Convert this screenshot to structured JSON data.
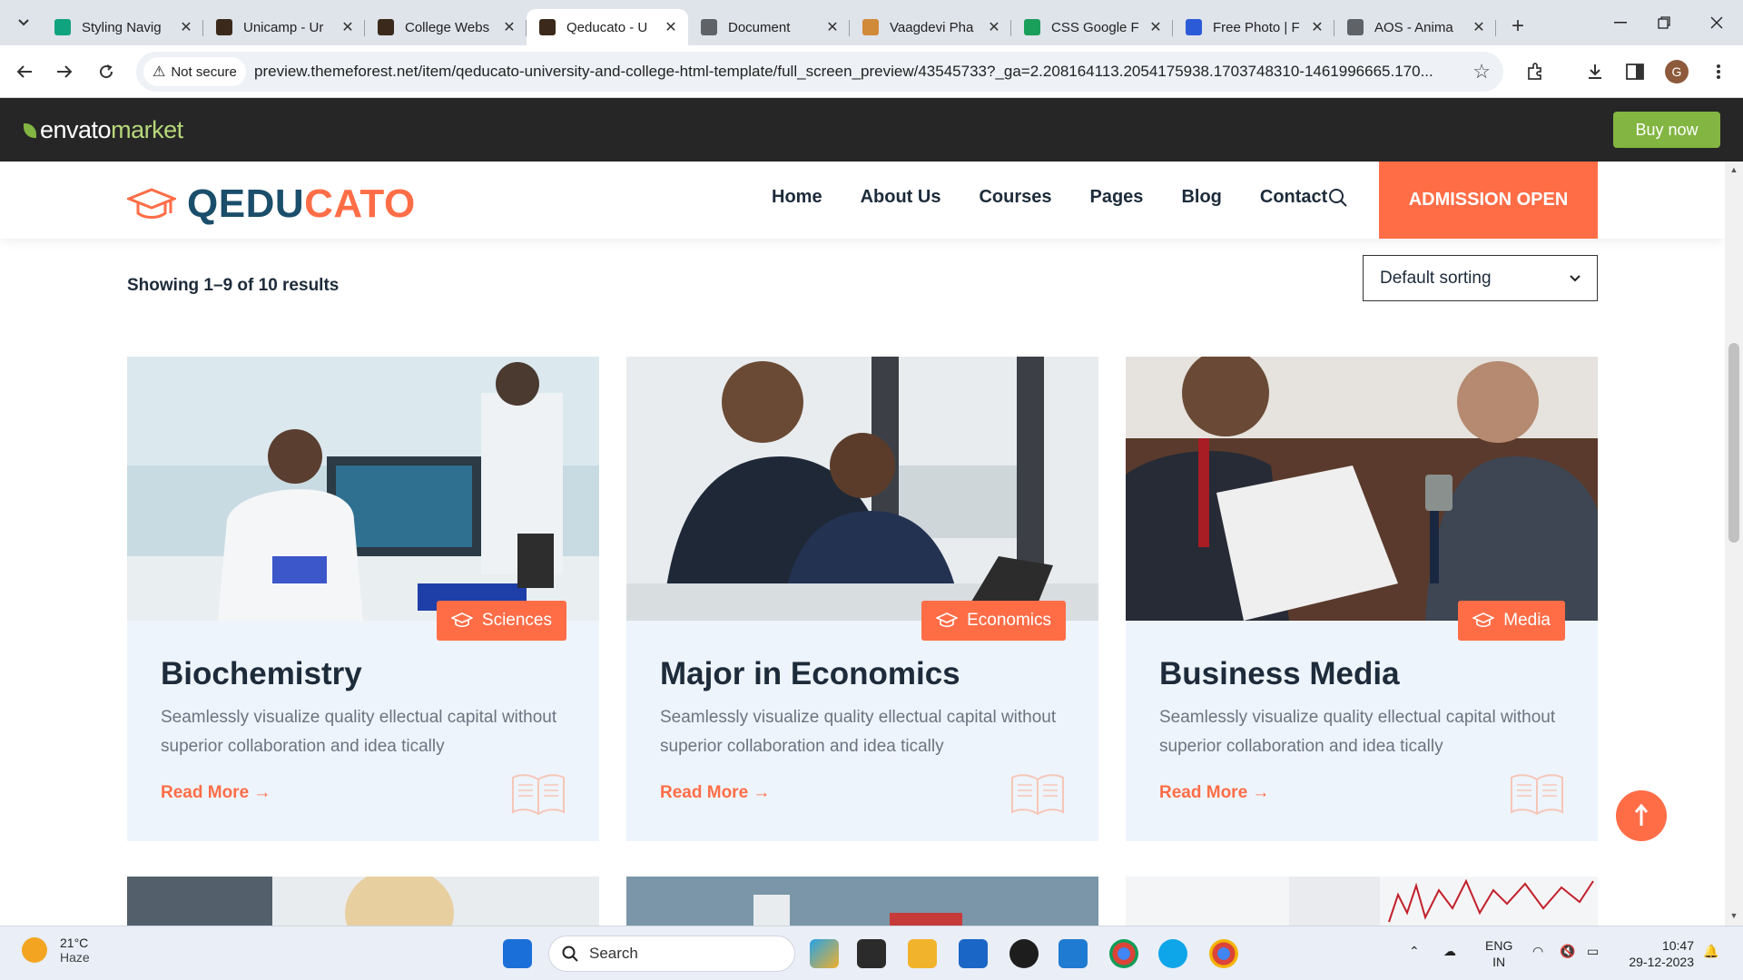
{
  "browser": {
    "tabs": [
      {
        "title": "Styling Navig",
        "favicon_color": "#10a37f"
      },
      {
        "title": "Unicamp - Ur",
        "favicon_color": "#3b2a1c"
      },
      {
        "title": "College Webs",
        "favicon_color": "#3b2a1c"
      },
      {
        "title": "Qeducato - U",
        "favicon_color": "#3b2a1c",
        "active": true
      },
      {
        "title": "Document",
        "favicon_color": "#5f6368"
      },
      {
        "title": "Vaagdevi Pha",
        "favicon_color": "#d08a3a"
      },
      {
        "title": "CSS Google F",
        "favicon_color": "#1a9f5b"
      },
      {
        "title": "Free Photo | F",
        "favicon_color": "#2b5bd7"
      },
      {
        "title": "AOS - Anima",
        "favicon_color": "#5f6368"
      }
    ],
    "new_tab": "+",
    "security_label": "Not secure",
    "url": "preview.themeforest.net/item/qeducato-university-and-college-html-template/full_screen_preview/43545733?_ga=2.208164113.2054175938.1703748310-1461996665.170...",
    "profile_initial": "G"
  },
  "envato": {
    "logo_main": "envato",
    "logo_sub": "market",
    "buy_label": "Buy now",
    "accent": "#82b541"
  },
  "site": {
    "brand_q": "QEDU",
    "brand_c": "CATO",
    "nav": [
      "Home",
      "About Us",
      "Courses",
      "Pages",
      "Blog",
      "Contact"
    ],
    "admission_label": "ADMISSION OPEN",
    "accent": "#ff6d47",
    "brand_dark": "#1a4e6b"
  },
  "listing": {
    "results_text": "Showing 1–9 of 10 results",
    "sort_value": "Default sorting",
    "read_more": "Read More →",
    "cards": [
      {
        "category": "Sciences",
        "title": "Biochemistry",
        "desc": "Seamlessly visualize quality ellectual capital without superior collaboration and idea tically"
      },
      {
        "category": "Economics",
        "title": "Major in Economics",
        "desc": "Seamlessly visualize quality ellectual capital without superior collaboration and idea tically"
      },
      {
        "category": "Media",
        "title": "Business Media",
        "desc": "Seamlessly visualize quality ellectual capital without superior collaboration and idea tically"
      }
    ]
  },
  "taskbar": {
    "temperature": "21°C",
    "condition": "Haze",
    "search_placeholder": "Search",
    "lang1": "ENG",
    "lang2": "IN",
    "time": "10:47",
    "date": "29-12-2023"
  }
}
